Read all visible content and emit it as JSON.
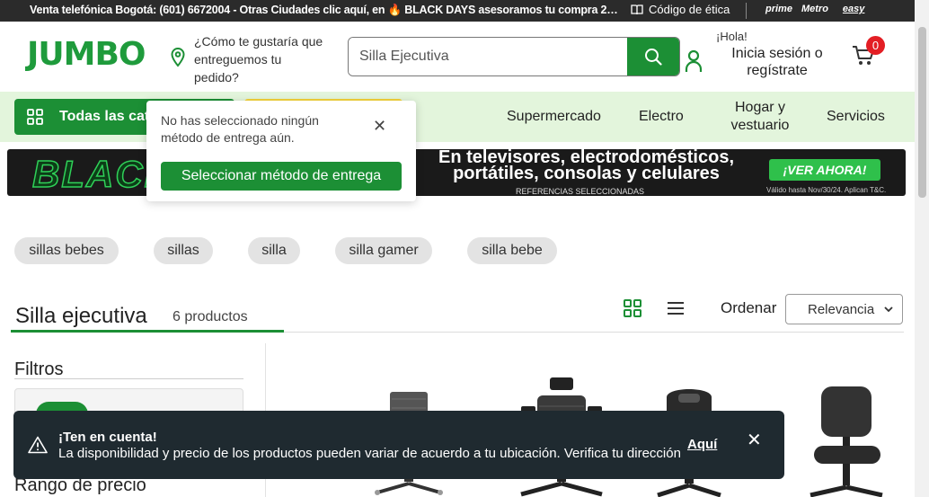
{
  "topbar": {
    "promo": "Venta telefónica Bogotá: (601) 6672004 - Otras Ciudades clic aquí, en 🔥 BLACK DAYS asesoramos tu compra 2…",
    "ethics": "Código de ética",
    "brands": [
      "prime",
      "Metro",
      "easy"
    ]
  },
  "header": {
    "logo": "JUMBO",
    "delivery_prompt": "¿Cómo te gustaría que entreguemos tu pedido?",
    "search_value": "Silla Ejecutiva",
    "greeting": "¡Hola!",
    "signin": "Inicia sesión o regístrate",
    "cart_count": "0"
  },
  "nav": {
    "all_categories": "Todas las categorías",
    "links": [
      "Supermercado",
      "Electro",
      "Hogar y vestuario",
      "Servicios"
    ]
  },
  "popover": {
    "message": "No has seleccionado ningún método de entrega aún.",
    "button": "Seleccionar método de entrega"
  },
  "banner": {
    "black": "BLACK",
    "headline": "En televisores, electrodomésticos, portátiles, consolas y celulares",
    "refs": "REFERENCIAS SELECCIONADAS",
    "cta": "¡VER AHORA!",
    "valid": "Válido hasta Nov/30/24. Aplican T&C."
  },
  "chips": [
    "sillas bebes",
    "sillas",
    "silla",
    "silla gamer",
    "silla bebe"
  ],
  "results": {
    "title": "Silla ejecutiva",
    "count": "6 productos",
    "sort_label": "Ordenar",
    "sort_value": "Relevancia"
  },
  "filters": {
    "title": "Filtros",
    "price_range": "Rango de precio"
  },
  "toast": {
    "title": "¡Ten en cuenta!",
    "message": "La disponibilidad y precio de los productos pueden variar de acuerdo a tu ubicación. Verifica tu dirección",
    "link": "Aquí"
  },
  "colors": {
    "brand_green": "#1c8f35",
    "nav_band": "#e3f5dc",
    "toast_bg": "#1f2a30",
    "badge_red": "#e31e24"
  }
}
